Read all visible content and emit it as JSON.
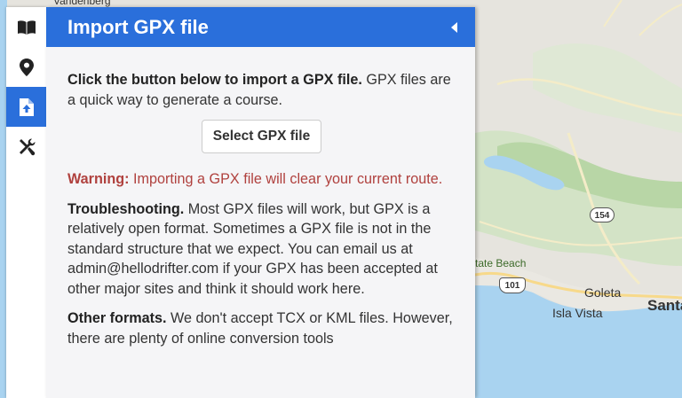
{
  "map": {
    "labels": {
      "vandenberg": "Vandenberg",
      "state_beach": "tate Beach",
      "goleta": "Goleta",
      "isla_vista": "Isla Vista",
      "santa": "Santa"
    },
    "shields": {
      "route_154": "154",
      "route_101": "101"
    },
    "colors": {
      "land": "#e6e4de",
      "water": "#a9d3f0",
      "park": "#b8d6a6",
      "road": "#f7f2d6"
    }
  },
  "toolbar": {
    "items": [
      {
        "name": "book-icon"
      },
      {
        "name": "map-pin-icon"
      },
      {
        "name": "file-upload-icon",
        "active": true
      },
      {
        "name": "tools-icon"
      }
    ]
  },
  "panel": {
    "title": "Import GPX file",
    "intro_bold": "Click the button below to import a GPX file.",
    "intro_rest": " GPX files are a quick way to generate a course.",
    "button_label": "Select GPX file",
    "warning_bold": "Warning:",
    "warning_rest": " Importing a GPX file will clear your current route.",
    "troubleshooting_bold": "Troubleshooting.",
    "troubleshooting_rest": " Most GPX files will work, but GPX is a relatively open format. Sometimes a GPX file is not in the standard structure that we expect. You can email us at admin@hellodrifter.com if your GPX has been accepted at other major sites and think it should work here.",
    "other_bold": "Other formats.",
    "other_rest": " We don't accept TCX or KML files. However, there are plenty of online conversion tools",
    "accent_color": "#2a6fdb",
    "warning_color": "#b0413e"
  }
}
